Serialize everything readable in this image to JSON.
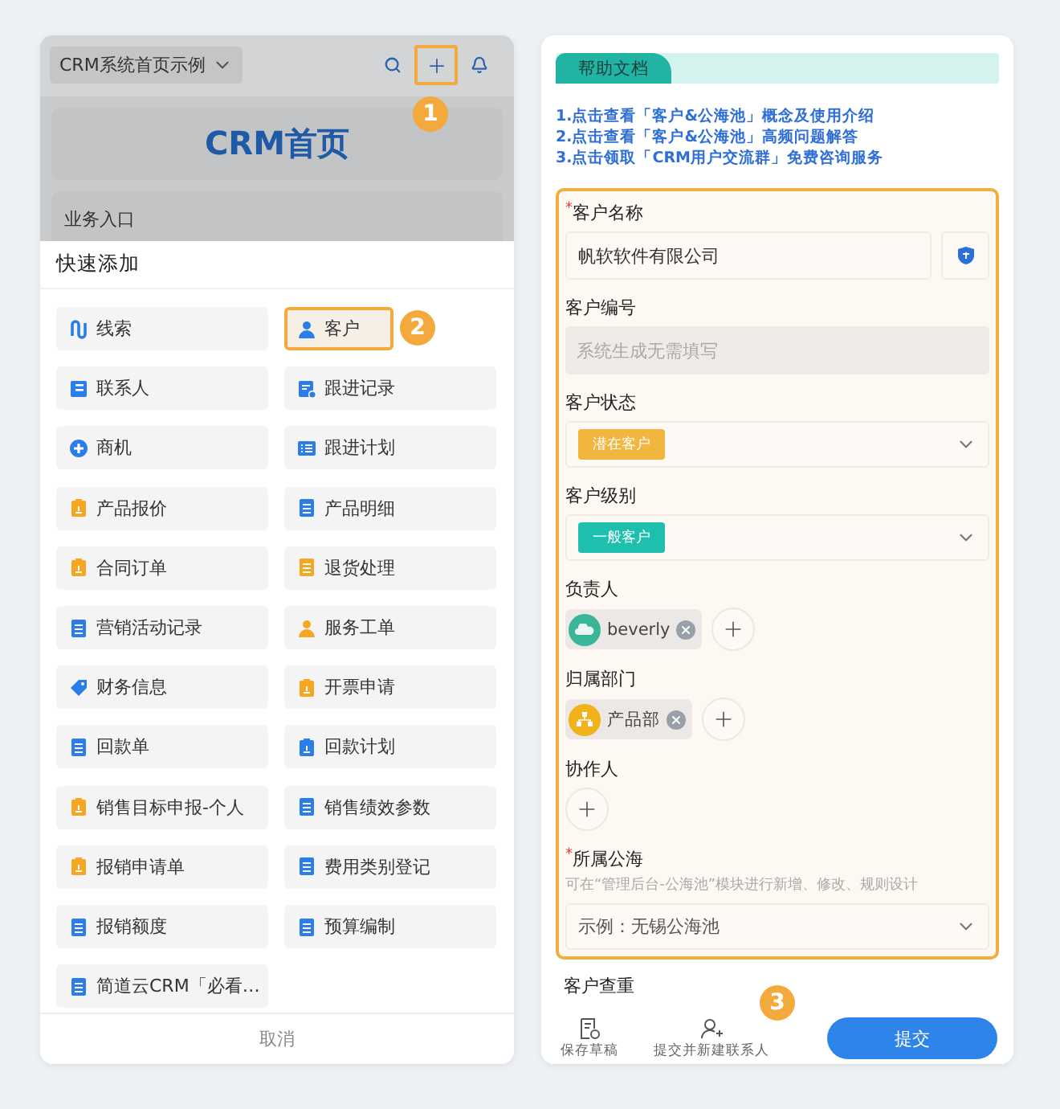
{
  "left_screen": {
    "header": {
      "title": "CRM系统首页示例",
      "add_button": {
        "highlighted": true,
        "callout": "1"
      }
    },
    "banner": {
      "title": "CRM首页"
    },
    "section": {
      "title": "业务入口"
    },
    "quick_add": {
      "title": "快速添加",
      "items": [
        {
          "label": "线索",
          "kind": "route",
          "color": "#2b7de9",
          "highlighted": false
        },
        {
          "label": "客户",
          "kind": "person",
          "color": "#2b7de9",
          "highlighted": true,
          "callout": "2"
        },
        {
          "label": "联系人",
          "kind": "card",
          "color": "#2b7de9",
          "highlighted": false
        },
        {
          "label": "跟进记录",
          "kind": "record",
          "color": "#2b7de9",
          "highlighted": false
        },
        {
          "label": "商机",
          "kind": "opportunity",
          "color": "#2b7de9",
          "highlighted": false
        },
        {
          "label": "跟进计划",
          "kind": "list",
          "color": "#2b7de9",
          "highlighted": false
        },
        {
          "label": "产品报价",
          "kind": "clipboard",
          "color": "#f5a623",
          "highlighted": false
        },
        {
          "label": "产品明细",
          "kind": "doc",
          "color": "#2b7de9",
          "highlighted": false
        },
        {
          "label": "合同订单",
          "kind": "clipboard",
          "color": "#f5a623",
          "highlighted": false
        },
        {
          "label": "退货处理",
          "kind": "doc",
          "color": "#f5a623",
          "highlighted": false
        },
        {
          "label": "营销活动记录",
          "kind": "doc",
          "color": "#2b7de9",
          "highlighted": false
        },
        {
          "label": "服务工单",
          "kind": "person",
          "color": "#f5a623",
          "highlighted": false
        },
        {
          "label": "财务信息",
          "kind": "tag",
          "color": "#2b7de9",
          "highlighted": false
        },
        {
          "label": "开票申请",
          "kind": "clipboard",
          "color": "#f5a623",
          "highlighted": false
        },
        {
          "label": "回款单",
          "kind": "doc",
          "color": "#2b7de9",
          "highlighted": false
        },
        {
          "label": "回款计划",
          "kind": "clipboard",
          "color": "#2b7de9",
          "highlighted": false
        },
        {
          "label": "销售目标申报-个人",
          "kind": "clipboard",
          "color": "#f5a623",
          "highlighted": false
        },
        {
          "label": "销售绩效参数",
          "kind": "doc",
          "color": "#2b7de9",
          "highlighted": false
        },
        {
          "label": "报销申请单",
          "kind": "clipboard",
          "color": "#f5a623",
          "highlighted": false
        },
        {
          "label": "费用类别登记",
          "kind": "doc",
          "color": "#2b7de9",
          "highlighted": false
        },
        {
          "label": "报销额度",
          "kind": "doc",
          "color": "#2b7de9",
          "highlighted": false
        },
        {
          "label": "预算编制",
          "kind": "doc",
          "color": "#2b7de9",
          "highlighted": false
        },
        {
          "label": "简道云CRM「必看…",
          "kind": "doc",
          "color": "#2b7de9",
          "highlighted": false
        }
      ],
      "cancel": "取消"
    }
  },
  "right_screen": {
    "help": {
      "tab": "帮助文档",
      "links": [
        "1.点击查看「客户&公海池」概念及使用介绍",
        "2.点击查看「客户&公海池」高频问题解答",
        "3.点击领取「CRM用户交流群」免费咨询服务"
      ]
    },
    "form": {
      "highlighted": true,
      "fields": [
        {
          "kind": "text",
          "label": "客户名称",
          "mark": "*",
          "value": "帆软软件有限公司"
        },
        {
          "kind": "readonly",
          "label": "客户编号",
          "placeholder": "系统生成无需填写"
        },
        {
          "kind": "tag-select",
          "label": "客户状态",
          "tag": "潜在客户",
          "color": "#f2b53d"
        },
        {
          "kind": "tag-select",
          "label": "客户级别",
          "tag": "一般客户",
          "color": "#1fbfb0"
        },
        {
          "kind": "people",
          "label": "负责人",
          "chips": [
            {
              "name": "beverly",
              "kind": "user"
            }
          ]
        },
        {
          "kind": "people",
          "label": "归属部门",
          "chips": [
            {
              "name": "产品部",
              "kind": "department"
            }
          ]
        },
        {
          "kind": "people",
          "label": "协作人"
        },
        {
          "kind": "select",
          "label": "所属公海",
          "mark": "*",
          "hint": "可在“管理后台-公海池”模块进行新增、修改、规则设计",
          "placeholder": "示例：无锡公海池"
        }
      ]
    },
    "next_field": {
      "label": "客户查重"
    },
    "footer": {
      "actions": [
        {
          "label": "保存草稿",
          "kind": "draft"
        },
        {
          "label": "提交并新建联系人",
          "kind": "add-contact"
        }
      ],
      "submit": "提交",
      "callout": "3"
    }
  }
}
